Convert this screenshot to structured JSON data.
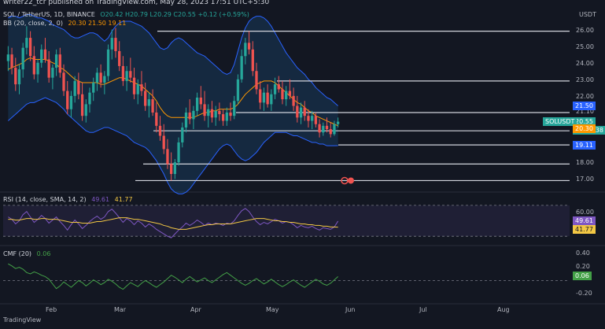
{
  "header": {
    "published_line": "writer22_tcr published on TradingView.com, May 28, 2023 17:51 UTC+5:30",
    "symbol_line": "SOL / TetherUS, 1D, BINANCE",
    "ohlc": "O20.42 H20.79 L20.29 C20.55 +0.12 (+0.59%)",
    "bb_label": "BB (20, close, 2, 0)",
    "bb_values": "20.30  21.50  19.11",
    "currency": "USDT",
    "logo_text": "TradingView"
  },
  "colors": {
    "background": "#131722",
    "up_candle": "#26a69a",
    "down_candle": "#ef5350",
    "bb_basis": "#ff9800",
    "bb_band": "#2962ff",
    "rsi_line": "#7e57c2",
    "rsi_ma": "#f2c744",
    "cmf_line": "#43a047",
    "level_line": "#d1d4dc"
  },
  "chart_data": [
    {
      "type": "candlestick",
      "title": "SOL / TetherUS, 1D, BINANCE",
      "y_axis_ticks": [
        "26.00",
        "25.00",
        "24.00",
        "23.00",
        "22.00",
        "21.10",
        "20.00",
        "19.15",
        "18.00",
        "17.00"
      ],
      "ylim": [
        16.5,
        27.5
      ],
      "x_tick_labels": [
        "Feb",
        "Mar",
        "Apr",
        "May",
        "Jun",
        "Jul",
        "Aug"
      ],
      "horizontal_levels": [
        26.0,
        23.0,
        21.1,
        20.0,
        19.15,
        18.0,
        17.0
      ],
      "price_tags": [
        {
          "label": "SOLUSDT",
          "value": "20.55",
          "sub": "11:38:38",
          "color": "#26a69a"
        },
        {
          "label": "",
          "value": "21.50",
          "color": "#2962ff"
        },
        {
          "label": "",
          "value": "20.30",
          "color": "#ff9800"
        },
        {
          "label": "",
          "value": "19.11",
          "color": "#2962ff"
        }
      ],
      "candles": [
        [
          24.2,
          25.1,
          23.6,
          24.6
        ],
        [
          24.6,
          25.0,
          23.4,
          23.8
        ],
        [
          23.8,
          24.4,
          22.4,
          22.8
        ],
        [
          22.8,
          24.0,
          22.2,
          23.7
        ],
        [
          23.7,
          25.3,
          23.2,
          25.0
        ],
        [
          25.0,
          26.3,
          24.6,
          25.6
        ],
        [
          25.6,
          26.0,
          24.2,
          24.5
        ],
        [
          24.5,
          25.1,
          23.1,
          23.4
        ],
        [
          23.4,
          24.3,
          22.9,
          24.1
        ],
        [
          24.1,
          25.2,
          23.8,
          24.9
        ],
        [
          24.9,
          25.6,
          24.1,
          24.3
        ],
        [
          24.3,
          24.8,
          22.9,
          23.2
        ],
        [
          23.2,
          24.0,
          22.5,
          23.8
        ],
        [
          23.8,
          24.9,
          23.3,
          24.6
        ],
        [
          24.6,
          25.0,
          23.2,
          23.5
        ],
        [
          23.5,
          24.0,
          22.1,
          22.4
        ],
        [
          22.4,
          23.0,
          21.0,
          21.3
        ],
        [
          21.3,
          22.4,
          20.8,
          22.1
        ],
        [
          22.1,
          23.3,
          21.7,
          23.0
        ],
        [
          23.0,
          23.5,
          21.9,
          22.2
        ],
        [
          22.2,
          22.9,
          20.6,
          20.9
        ],
        [
          20.9,
          21.9,
          20.5,
          21.6
        ],
        [
          21.6,
          22.6,
          21.1,
          22.3
        ],
        [
          22.3,
          23.2,
          21.8,
          22.9
        ],
        [
          22.9,
          23.8,
          22.4,
          23.5
        ],
        [
          23.5,
          24.0,
          22.6,
          22.9
        ],
        [
          22.9,
          23.6,
          22.2,
          23.3
        ],
        [
          23.3,
          25.2,
          23.0,
          24.9
        ],
        [
          24.9,
          26.1,
          24.3,
          25.6
        ],
        [
          25.6,
          26.2,
          24.4,
          24.8
        ],
        [
          24.8,
          25.4,
          23.6,
          23.9
        ],
        [
          23.9,
          24.5,
          22.7,
          23.0
        ],
        [
          23.0,
          23.9,
          22.4,
          23.6
        ],
        [
          23.6,
          24.4,
          22.9,
          23.2
        ],
        [
          23.2,
          23.8,
          21.9,
          22.2
        ],
        [
          22.2,
          23.1,
          21.6,
          22.8
        ],
        [
          22.8,
          23.6,
          22.1,
          22.4
        ],
        [
          22.4,
          22.9,
          21.2,
          21.5
        ],
        [
          21.5,
          22.3,
          20.8,
          21.9
        ],
        [
          21.9,
          22.5,
          20.9,
          21.1
        ],
        [
          21.1,
          21.7,
          19.9,
          20.3
        ],
        [
          20.3,
          20.9,
          19.4,
          19.7
        ],
        [
          19.7,
          20.4,
          18.6,
          18.9
        ],
        [
          18.9,
          19.5,
          17.7,
          18.0
        ],
        [
          18.0,
          18.7,
          17.0,
          17.4
        ],
        [
          17.4,
          18.3,
          17.1,
          18.1
        ],
        [
          18.1,
          19.6,
          17.9,
          19.3
        ],
        [
          19.3,
          20.5,
          19.0,
          20.2
        ],
        [
          20.2,
          21.4,
          19.9,
          21.1
        ],
        [
          21.1,
          21.9,
          20.4,
          20.7
        ],
        [
          20.7,
          21.5,
          20.1,
          21.2
        ],
        [
          21.2,
          22.3,
          20.9,
          22.0
        ],
        [
          22.0,
          22.7,
          21.3,
          21.6
        ],
        [
          21.6,
          22.4,
          20.6,
          20.9
        ],
        [
          20.9,
          21.6,
          20.2,
          21.3
        ],
        [
          21.3,
          21.8,
          20.5,
          20.8
        ],
        [
          20.8,
          21.5,
          20.3,
          21.2
        ],
        [
          21.2,
          21.7,
          20.6,
          21.0
        ],
        [
          21.0,
          21.3,
          20.3,
          20.6
        ],
        [
          20.6,
          21.4,
          20.3,
          21.1
        ],
        [
          21.1,
          21.7,
          20.6,
          20.9
        ],
        [
          20.9,
          22.1,
          20.7,
          21.8
        ],
        [
          21.8,
          23.4,
          21.6,
          23.1
        ],
        [
          23.1,
          24.9,
          22.9,
          24.5
        ],
        [
          24.5,
          25.6,
          24.0,
          25.3
        ],
        [
          25.3,
          26.0,
          24.6,
          24.9
        ],
        [
          24.9,
          25.4,
          23.3,
          23.6
        ],
        [
          23.6,
          24.1,
          22.2,
          22.5
        ],
        [
          22.5,
          23.0,
          21.3,
          21.7
        ],
        [
          21.7,
          22.6,
          21.2,
          22.3
        ],
        [
          22.3,
          22.8,
          21.4,
          21.6
        ],
        [
          21.6,
          22.5,
          21.2,
          22.2
        ],
        [
          22.2,
          23.2,
          21.9,
          22.8
        ],
        [
          22.8,
          23.3,
          22.3,
          22.5
        ],
        [
          22.5,
          23.0,
          21.6,
          21.9
        ],
        [
          21.9,
          22.7,
          21.5,
          22.4
        ],
        [
          22.4,
          23.1,
          21.9,
          22.1
        ],
        [
          22.1,
          22.6,
          21.2,
          21.5
        ],
        [
          21.5,
          22.1,
          20.5,
          20.8
        ],
        [
          20.8,
          21.7,
          20.4,
          21.4
        ],
        [
          21.4,
          21.8,
          20.6,
          20.9
        ],
        [
          20.9,
          21.3,
          20.2,
          20.6
        ],
        [
          20.6,
          21.2,
          20.1,
          20.9
        ],
        [
          20.9,
          21.1,
          20.2,
          20.4
        ],
        [
          20.4,
          20.7,
          19.6,
          19.9
        ],
        [
          19.9,
          20.5,
          19.7,
          20.3
        ],
        [
          20.3,
          20.8,
          19.9,
          20.1
        ],
        [
          20.1,
          20.5,
          19.6,
          19.8
        ],
        [
          19.8,
          20.6,
          19.7,
          20.4
        ],
        [
          20.4,
          20.8,
          20.2,
          20.55
        ]
      ],
      "bb_upper": [
        26.8,
        26.9,
        26.9,
        26.8,
        26.9,
        27.0,
        27.0,
        26.9,
        26.8,
        26.8,
        26.7,
        26.6,
        26.4,
        26.3,
        26.2,
        26.1,
        25.9,
        25.7,
        25.6,
        25.6,
        25.7,
        25.8,
        25.9,
        25.9,
        25.8,
        25.6,
        25.4,
        25.6,
        26.0,
        26.3,
        26.5,
        26.6,
        26.6,
        26.6,
        26.5,
        26.4,
        26.3,
        26.1,
        25.9,
        25.6,
        25.3,
        25.0,
        24.9,
        25.0,
        25.3,
        25.5,
        25.6,
        25.5,
        25.3,
        25.1,
        24.9,
        24.7,
        24.6,
        24.5,
        24.3,
        24.1,
        23.9,
        23.7,
        23.5,
        23.4,
        23.5,
        24.0,
        24.8,
        25.6,
        26.2,
        26.6,
        26.8,
        26.9,
        26.9,
        26.8,
        26.6,
        26.3,
        25.9,
        25.5,
        25.1,
        24.7,
        24.4,
        24.1,
        23.8,
        23.6,
        23.4,
        23.1,
        22.9,
        22.6,
        22.4,
        22.2,
        22.0,
        21.9,
        21.7,
        21.5
      ],
      "bb_lower": [
        20.6,
        20.8,
        21.0,
        21.2,
        21.4,
        21.6,
        21.7,
        21.7,
        21.8,
        21.9,
        22.0,
        21.9,
        21.8,
        21.7,
        21.5,
        21.3,
        21.0,
        20.8,
        20.6,
        20.4,
        20.2,
        20.0,
        19.9,
        19.9,
        20.0,
        20.1,
        20.2,
        20.2,
        20.1,
        20.0,
        19.9,
        19.8,
        19.7,
        19.5,
        19.3,
        19.2,
        19.1,
        19.0,
        18.8,
        18.5,
        18.2,
        17.8,
        17.4,
        16.9,
        16.5,
        16.3,
        16.2,
        16.2,
        16.3,
        16.5,
        16.8,
        17.1,
        17.4,
        17.7,
        18.0,
        18.3,
        18.6,
        18.9,
        19.1,
        19.2,
        19.1,
        18.8,
        18.5,
        18.3,
        18.2,
        18.3,
        18.5,
        18.7,
        19.0,
        19.3,
        19.5,
        19.7,
        19.9,
        19.9,
        19.9,
        19.9,
        19.8,
        19.7,
        19.7,
        19.6,
        19.5,
        19.4,
        19.3,
        19.3,
        19.2,
        19.2,
        19.1,
        19.1,
        19.1,
        19.11
      ],
      "bb_basis": [
        23.7,
        23.8,
        23.9,
        24.0,
        24.1,
        24.3,
        24.4,
        24.3,
        24.3,
        24.3,
        24.3,
        24.2,
        24.1,
        24.0,
        23.8,
        23.7,
        23.5,
        23.3,
        23.1,
        23.0,
        22.9,
        22.9,
        22.9,
        22.9,
        22.9,
        22.8,
        22.8,
        22.9,
        23.0,
        23.1,
        23.2,
        23.2,
        23.1,
        23.0,
        22.9,
        22.8,
        22.7,
        22.5,
        22.3,
        22.1,
        21.8,
        21.4,
        21.1,
        20.9,
        20.8,
        20.8,
        20.8,
        20.8,
        20.8,
        20.8,
        20.8,
        20.9,
        21.0,
        21.1,
        21.1,
        21.2,
        21.2,
        21.3,
        21.3,
        21.3,
        21.3,
        21.4,
        21.6,
        21.9,
        22.2,
        22.4,
        22.6,
        22.8,
        22.9,
        23.0,
        23.0,
        23.0,
        22.9,
        22.7,
        22.5,
        22.3,
        22.1,
        21.9,
        21.7,
        21.6,
        21.4,
        21.2,
        21.1,
        20.9,
        20.8,
        20.7,
        20.6,
        20.5,
        20.4,
        20.3
      ]
    },
    {
      "type": "line",
      "title": "RSI (14, close, SMA, 14, 2)",
      "values_label": [
        "49.61",
        "41.77"
      ],
      "y_axis_ticks": [
        "60.00"
      ],
      "ylim": [
        20,
        75
      ],
      "upper_band": 70,
      "lower_band": 30,
      "series": [
        {
          "name": "RSI",
          "values": [
            55,
            52,
            46,
            50,
            58,
            62,
            55,
            48,
            52,
            57,
            53,
            47,
            51,
            55,
            49,
            44,
            38,
            45,
            51,
            46,
            40,
            44,
            49,
            53,
            56,
            52,
            55,
            62,
            65,
            60,
            54,
            48,
            53,
            50,
            45,
            50,
            47,
            42,
            46,
            43,
            39,
            36,
            33,
            30,
            28,
            33,
            38,
            42,
            47,
            44,
            47,
            51,
            48,
            44,
            47,
            45,
            47,
            46,
            44,
            47,
            46,
            50,
            57,
            63,
            66,
            62,
            55,
            49,
            45,
            48,
            46,
            49,
            52,
            50,
            47,
            49,
            48,
            45,
            41,
            44,
            42,
            41,
            43,
            40,
            38,
            41,
            40,
            39,
            42,
            49.61
          ]
        },
        {
          "name": "MA",
          "values": [
            52,
            52,
            51,
            51,
            52,
            53,
            53,
            52,
            52,
            53,
            53,
            52,
            52,
            52,
            51,
            50,
            49,
            48,
            48,
            48,
            47,
            47,
            47,
            48,
            49,
            49,
            50,
            51,
            52,
            53,
            54,
            54,
            54,
            53,
            52,
            52,
            51,
            50,
            49,
            48,
            47,
            46,
            44,
            43,
            41,
            40,
            39,
            39,
            39,
            40,
            41,
            42,
            43,
            44,
            45,
            45,
            46,
            46,
            46,
            46,
            46,
            47,
            48,
            49,
            50,
            51,
            52,
            53,
            53,
            53,
            52,
            51,
            50,
            50,
            49,
            49,
            48,
            48,
            47,
            46,
            46,
            45,
            45,
            44,
            44,
            43,
            43,
            42,
            42,
            41.77
          ]
        }
      ]
    },
    {
      "type": "line",
      "title": "CMF (20)",
      "values_label": [
        "0.06"
      ],
      "y_axis_ticks": [
        "0.40",
        "0.20",
        "-0.20"
      ],
      "ylim": [
        -0.3,
        0.5
      ],
      "series": [
        {
          "name": "CMF",
          "values": [
            0.25,
            0.22,
            0.18,
            0.2,
            0.17,
            0.12,
            0.1,
            0.13,
            0.11,
            0.08,
            0.06,
            0.02,
            -0.05,
            -0.12,
            -0.08,
            -0.02,
            -0.06,
            -0.1,
            -0.05,
            0.0,
            -0.03,
            -0.08,
            -0.04,
            0.01,
            -0.02,
            -0.06,
            -0.03,
            0.02,
            -0.01,
            -0.05,
            -0.1,
            -0.13,
            -0.08,
            -0.03,
            -0.06,
            -0.09,
            -0.04,
            0.0,
            -0.03,
            -0.07,
            -0.1,
            -0.06,
            -0.02,
            0.03,
            0.08,
            0.05,
            0.01,
            -0.03,
            0.02,
            0.06,
            0.02,
            -0.02,
            0.01,
            0.04,
            0.0,
            -0.03,
            0.01,
            0.05,
            0.09,
            0.12,
            0.08,
            0.04,
            0.0,
            -0.04,
            -0.07,
            -0.04,
            0.0,
            0.03,
            -0.01,
            -0.05,
            -0.02,
            0.02,
            -0.02,
            -0.06,
            -0.09,
            -0.06,
            -0.02,
            0.01,
            -0.03,
            -0.07,
            -0.1,
            -0.06,
            -0.02,
            0.02,
            -0.01,
            -0.05,
            -0.07,
            -0.04,
            0.01,
            0.06
          ]
        }
      ]
    }
  ]
}
